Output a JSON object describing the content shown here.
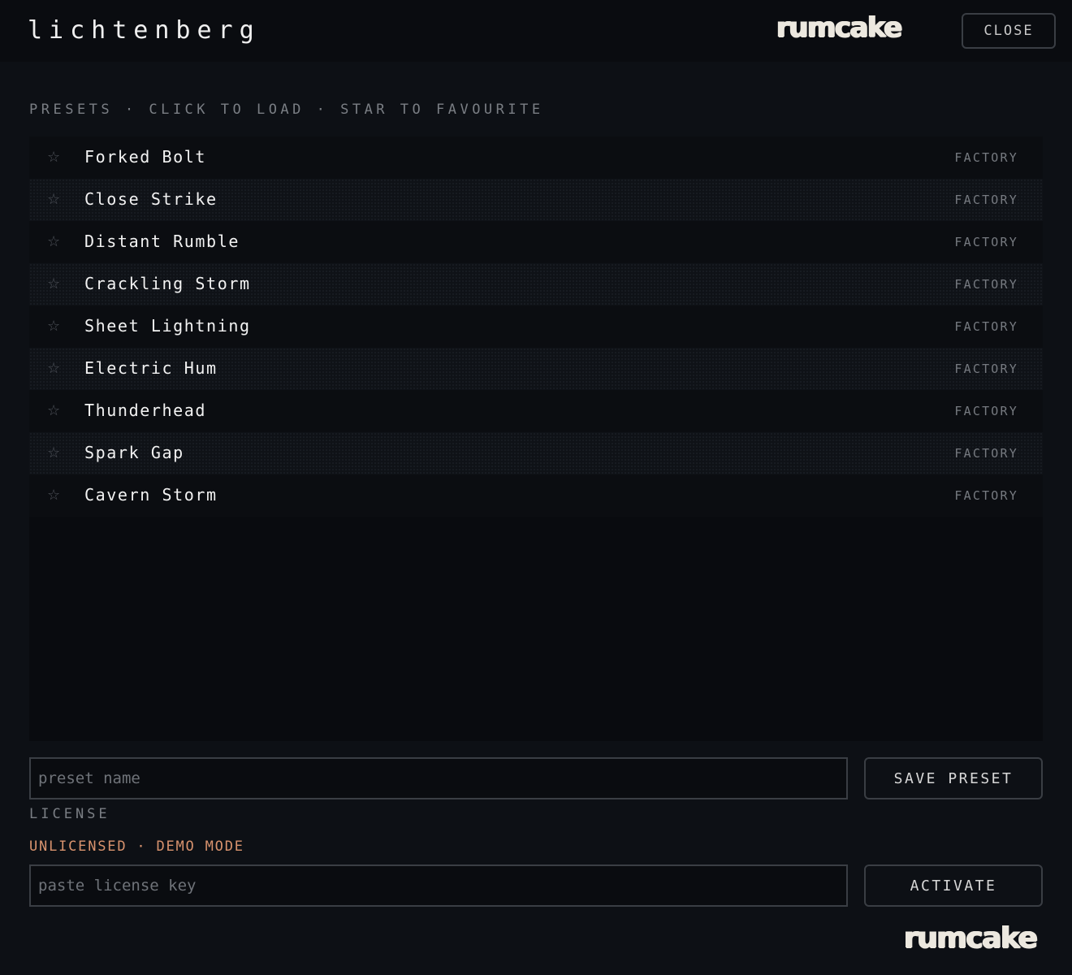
{
  "header": {
    "app_title": "lichtenberg",
    "brand": "rumcake",
    "close_label": "CLOSE"
  },
  "presets_section": {
    "label": "PRESETS · CLICK TO LOAD · STAR TO FAVOURITE",
    "star_glyph": "☆",
    "items": [
      {
        "name": "Forked Bolt",
        "tag": "FACTORY"
      },
      {
        "name": "Close Strike",
        "tag": "FACTORY"
      },
      {
        "name": "Distant Rumble",
        "tag": "FACTORY"
      },
      {
        "name": "Crackling Storm",
        "tag": "FACTORY"
      },
      {
        "name": "Sheet Lightning",
        "tag": "FACTORY"
      },
      {
        "name": "Electric Hum",
        "tag": "FACTORY"
      },
      {
        "name": "Thunderhead",
        "tag": "FACTORY"
      },
      {
        "name": "Spark Gap",
        "tag": "FACTORY"
      },
      {
        "name": "Cavern Storm",
        "tag": "FACTORY"
      }
    ]
  },
  "save_preset": {
    "placeholder": "preset name",
    "value": "",
    "button_label": "SAVE PRESET"
  },
  "license": {
    "label": "LICENSE",
    "status": "UNLICENSED · DEMO MODE",
    "status_color": "#d9936e",
    "placeholder": "paste license key",
    "value": "",
    "button_label": "ACTIVATE"
  },
  "footer": {
    "brand": "rumcake"
  }
}
